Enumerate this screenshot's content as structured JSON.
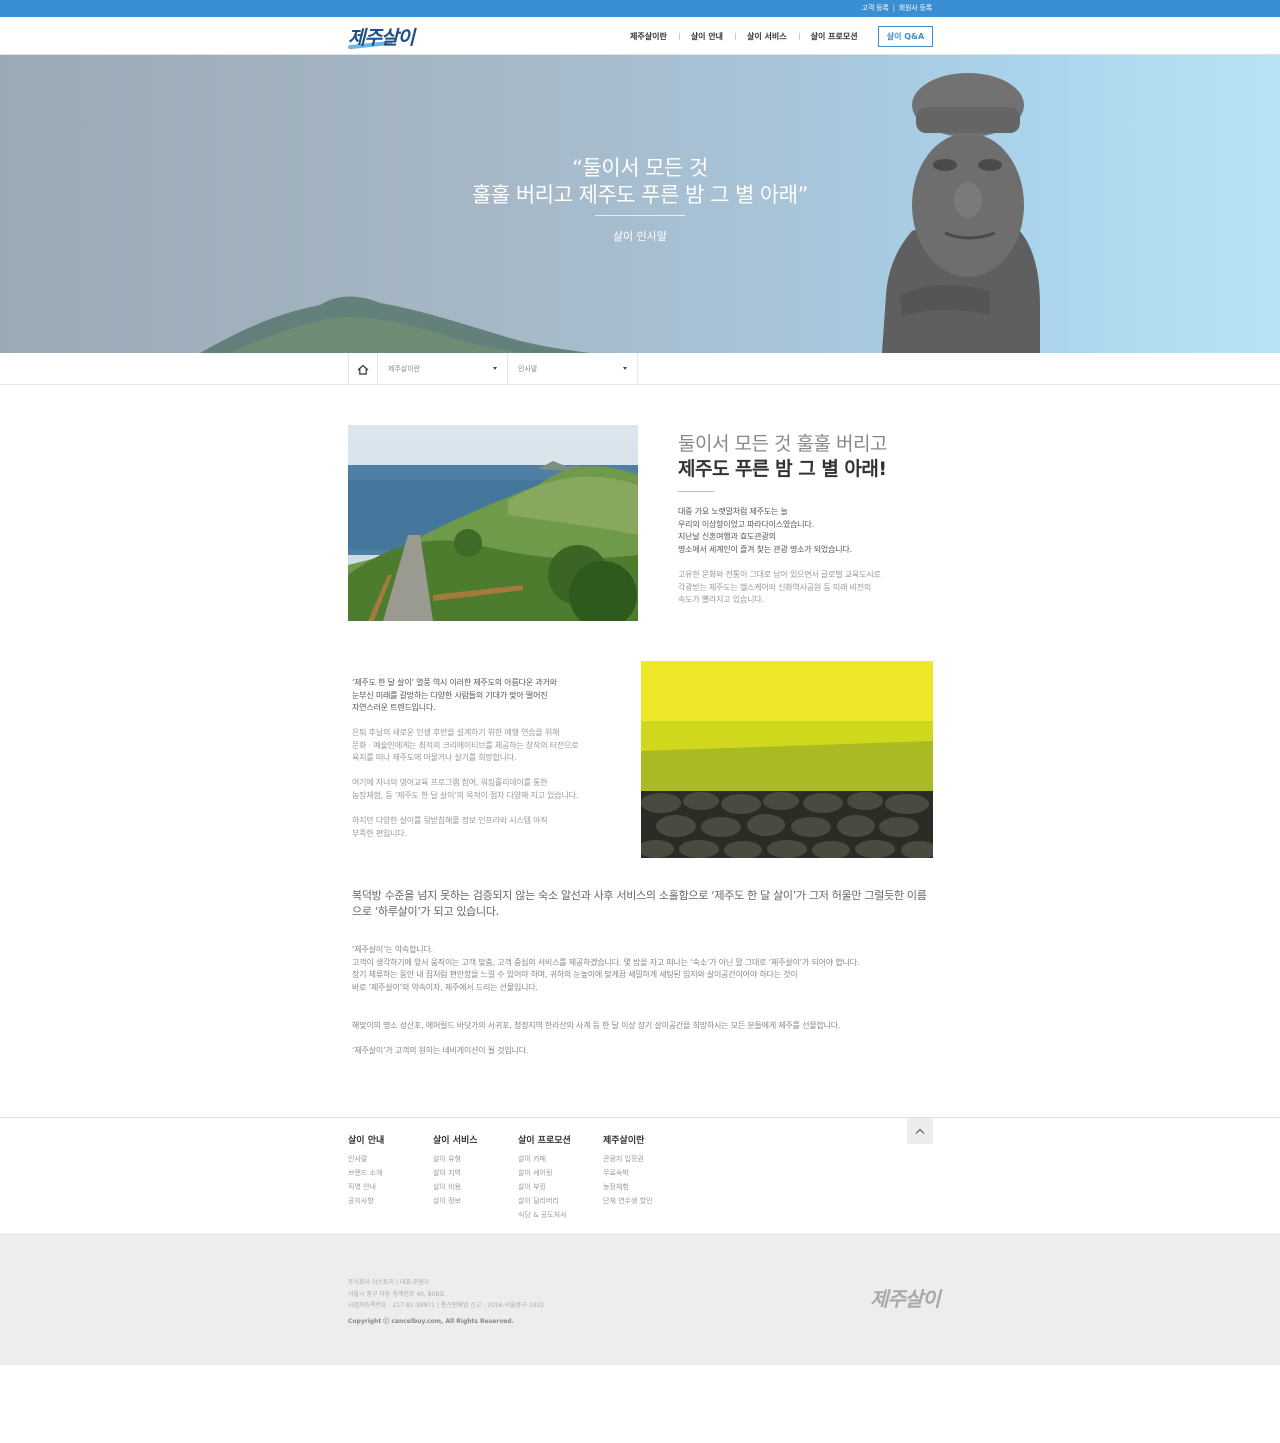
{
  "utility": {
    "links": [
      "고객 등록",
      "회원사 등록"
    ],
    "separator": "|"
  },
  "header": {
    "logo_text": "제주살이",
    "nav": [
      "제주살이란",
      "살이 안내",
      "살이 서비스",
      "살이 프로모션"
    ],
    "qna_label": "살이 Q&A",
    "accent": "#3a8fd2"
  },
  "hero": {
    "quote_line1": "“둘이서 모든 것",
    "quote_line2": "훌훌 버리고 제주도 푸른 밤 그 별 아래”",
    "subtitle": "살이 인사말"
  },
  "breadcrumb": {
    "home_icon": "home-icon",
    "level1": "제주살이란",
    "level2": "인사말"
  },
  "intro": {
    "title_light": "둘이서 모든 것 훌훌 버리고",
    "title_bold": "제주도 푸른 밤 그 별 아래!",
    "para1": "대중 가요 노랫말처럼 제주도는 늘\n우리의 이상향이었고 파라다이스였습니다.\n지난날 신혼여행과 효도관광의\n명소에서 세계인이 즐겨 찾는 관광 명소가 되었습니다.",
    "para2": "고유한 문화와 전통이 그대로 남아 있으면서 글로벌 교육도시로\n각광받는 제주도는 헬스케어와 신화역사공원 등 미래 비전의\n속도가 빨라지고 있습니다."
  },
  "section2": {
    "para1": "‘제주도 한 달 살이’ 열풍 역시 이러한 제주도의 아름다운 과거와\n눈부신 미래를 갈망하는 다양한 사람들의 기대가 맞아 떨어진\n자연스러운 트렌드입니다.",
    "para2": "은퇴 후날의 새로운 인생 후반을 설계하기 위한 예행 연습을 위해\n문화 · 예술인에게는 최적의 크리에이티브를 체공하는 창작의 터전으로\n육지를 떠나 제주도에 머물거나 살기를 희망합니다.",
    "para3": "여기에 자녀의 영어교육 프로그램 참여, 워킹홀리데이를 통한\n농장체험, 등 ‘제주도 한 달 살이’의 목적이 점차 다양해 지고 있습니다.",
    "para4": "하지만 다양한 살이를 뒷받침해줄 정보 인프라와 시스템 아직\n부족한 편입니다."
  },
  "section3": {
    "lead": "복덕방 수준을 넘지 못하는 검증되지 않는 숙소 알선과 사후 서비스의 소홀함으로 ‘제주도 한 달 살이’가 그저 허울만 그럴듯한 이름으로 ‘하루살이’가 되고 있습니다.",
    "para1": "‘제주살이’는 약속합니다.\n고객이 생각하기에 앞서 움직이는 고객 맞춤, 고객 중심의 서비스를 제공하겠습니다. 몇 밤을 자고 떠나는 ‘숙소’가 아닌 말 그대로 ‘제주살이’가 되어야 합니다.\n장기 체류하는 동안 내 집처럼 편안함을 느낄 수 있어야 하며, 귀하의 눈높이에 맞게끔 세밀하게 세팅된 입지와 살이공간이어야 하다는 것이\n바로 ‘제주살이’의 약속이자, 제주에서 드리는 선물입니다.",
    "para2": "해맞이의 명소 성산포, 에머럴드 바닷가의 서귀포, 청정지역 한라산의 사계 등 한 달 이상 장기 살이공간을 희망하시는 모든 분들에게 제주를 선물합니다.",
    "para3": "‘제주살이’가 고객의 원하는 네비게이션이 될 것입니다."
  },
  "footer": {
    "columns": [
      {
        "title": "살이 안내",
        "links": [
          "인사말",
          "브랜드 소개",
          "직영 안내",
          "공지사항"
        ]
      },
      {
        "title": "살이 서비스",
        "links": [
          "살이 유형",
          "살이 지역",
          "살이 비용",
          "살이 정보"
        ]
      },
      {
        "title": "살이 프로모션",
        "links": [
          "살이 카페",
          "살이 셰어링",
          "살이 부킹",
          "살이 딜리버리",
          "식당 & 공도처사"
        ]
      },
      {
        "title": "제주살이란",
        "links": [
          "관광지 입장권",
          "무료숙박",
          "농장체험",
          "단체 연수생 할인"
        ]
      }
    ],
    "company": "주식회사 이스토리 | 대표:주원우",
    "address": "서울시 중구 다동 청계천로 40, 808호",
    "registration": "사업자등록번호 : 217-81-38971 | 통신판매업 신고 : 2016-서울중구-1932",
    "copyright": "Copyright ⓒ cancelbuy.com, All Rights Reserved.",
    "logo_text": "제주살이",
    "top_icon": "chevron-up-icon"
  }
}
